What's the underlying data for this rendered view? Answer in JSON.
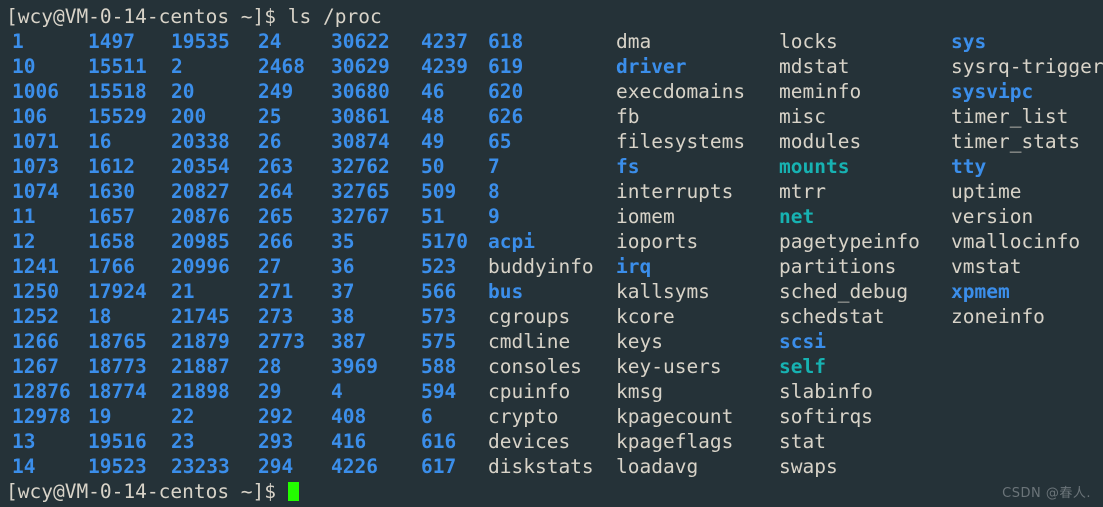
{
  "terminal": {
    "background_color": "#253238",
    "colors": {
      "file": "#d8d3c8",
      "directory": "#3b8eea",
      "symlink": "#17b2b2",
      "cursor": "#23fd00",
      "watermark": "#6b7479"
    },
    "prompt_top": "[wcy@VM-0-14-centos ~]$ ls /proc",
    "prompt_bottom": "[wcy@VM-0-14-centos ~]$ ",
    "watermark": "CSDN @春人.",
    "column_x": [
      6,
      82,
      165,
      252,
      325,
      415,
      482,
      610,
      773,
      945
    ],
    "rows": [
      [
        {
          "t": "1",
          "k": "dir"
        },
        {
          "t": "1497",
          "k": "dir"
        },
        {
          "t": "19535",
          "k": "dir"
        },
        {
          "t": "24",
          "k": "dir"
        },
        {
          "t": "30622",
          "k": "dir"
        },
        {
          "t": "4237",
          "k": "dir"
        },
        {
          "t": "618",
          "k": "dir"
        },
        {
          "t": "dma",
          "k": "file"
        },
        {
          "t": "locks",
          "k": "file"
        },
        {
          "t": "sys",
          "k": "dir"
        }
      ],
      [
        {
          "t": "10",
          "k": "dir"
        },
        {
          "t": "15511",
          "k": "dir"
        },
        {
          "t": "2",
          "k": "dir"
        },
        {
          "t": "2468",
          "k": "dir"
        },
        {
          "t": "30629",
          "k": "dir"
        },
        {
          "t": "4239",
          "k": "dir"
        },
        {
          "t": "619",
          "k": "dir"
        },
        {
          "t": "driver",
          "k": "dir"
        },
        {
          "t": "mdstat",
          "k": "file"
        },
        {
          "t": "sysrq-trigger",
          "k": "file"
        }
      ],
      [
        {
          "t": "1006",
          "k": "dir"
        },
        {
          "t": "15518",
          "k": "dir"
        },
        {
          "t": "20",
          "k": "dir"
        },
        {
          "t": "249",
          "k": "dir"
        },
        {
          "t": "30680",
          "k": "dir"
        },
        {
          "t": "46",
          "k": "dir"
        },
        {
          "t": "620",
          "k": "dir"
        },
        {
          "t": "execdomains",
          "k": "file"
        },
        {
          "t": "meminfo",
          "k": "file"
        },
        {
          "t": "sysvipc",
          "k": "dir"
        }
      ],
      [
        {
          "t": "106",
          "k": "dir"
        },
        {
          "t": "15529",
          "k": "dir"
        },
        {
          "t": "200",
          "k": "dir"
        },
        {
          "t": "25",
          "k": "dir"
        },
        {
          "t": "30861",
          "k": "dir"
        },
        {
          "t": "48",
          "k": "dir"
        },
        {
          "t": "626",
          "k": "dir"
        },
        {
          "t": "fb",
          "k": "file"
        },
        {
          "t": "misc",
          "k": "file"
        },
        {
          "t": "timer_list",
          "k": "file"
        }
      ],
      [
        {
          "t": "1071",
          "k": "dir"
        },
        {
          "t": "16",
          "k": "dir"
        },
        {
          "t": "20338",
          "k": "dir"
        },
        {
          "t": "26",
          "k": "dir"
        },
        {
          "t": "30874",
          "k": "dir"
        },
        {
          "t": "49",
          "k": "dir"
        },
        {
          "t": "65",
          "k": "dir"
        },
        {
          "t": "filesystems",
          "k": "file"
        },
        {
          "t": "modules",
          "k": "file"
        },
        {
          "t": "timer_stats",
          "k": "file"
        }
      ],
      [
        {
          "t": "1073",
          "k": "dir"
        },
        {
          "t": "1612",
          "k": "dir"
        },
        {
          "t": "20354",
          "k": "dir"
        },
        {
          "t": "263",
          "k": "dir"
        },
        {
          "t": "32762",
          "k": "dir"
        },
        {
          "t": "50",
          "k": "dir"
        },
        {
          "t": "7",
          "k": "dir"
        },
        {
          "t": "fs",
          "k": "dir"
        },
        {
          "t": "mounts",
          "k": "link"
        },
        {
          "t": "tty",
          "k": "dir"
        }
      ],
      [
        {
          "t": "1074",
          "k": "dir"
        },
        {
          "t": "1630",
          "k": "dir"
        },
        {
          "t": "20827",
          "k": "dir"
        },
        {
          "t": "264",
          "k": "dir"
        },
        {
          "t": "32765",
          "k": "dir"
        },
        {
          "t": "509",
          "k": "dir"
        },
        {
          "t": "8",
          "k": "dir"
        },
        {
          "t": "interrupts",
          "k": "file"
        },
        {
          "t": "mtrr",
          "k": "file"
        },
        {
          "t": "uptime",
          "k": "file"
        }
      ],
      [
        {
          "t": "11",
          "k": "dir"
        },
        {
          "t": "1657",
          "k": "dir"
        },
        {
          "t": "20876",
          "k": "dir"
        },
        {
          "t": "265",
          "k": "dir"
        },
        {
          "t": "32767",
          "k": "dir"
        },
        {
          "t": "51",
          "k": "dir"
        },
        {
          "t": "9",
          "k": "dir"
        },
        {
          "t": "iomem",
          "k": "file"
        },
        {
          "t": "net",
          "k": "link"
        },
        {
          "t": "version",
          "k": "file"
        }
      ],
      [
        {
          "t": "12",
          "k": "dir"
        },
        {
          "t": "1658",
          "k": "dir"
        },
        {
          "t": "20985",
          "k": "dir"
        },
        {
          "t": "266",
          "k": "dir"
        },
        {
          "t": "35",
          "k": "dir"
        },
        {
          "t": "5170",
          "k": "dir"
        },
        {
          "t": "acpi",
          "k": "dir"
        },
        {
          "t": "ioports",
          "k": "file"
        },
        {
          "t": "pagetypeinfo",
          "k": "file"
        },
        {
          "t": "vmallocinfo",
          "k": "file"
        }
      ],
      [
        {
          "t": "1241",
          "k": "dir"
        },
        {
          "t": "1766",
          "k": "dir"
        },
        {
          "t": "20996",
          "k": "dir"
        },
        {
          "t": "27",
          "k": "dir"
        },
        {
          "t": "36",
          "k": "dir"
        },
        {
          "t": "523",
          "k": "dir"
        },
        {
          "t": "buddyinfo",
          "k": "file"
        },
        {
          "t": "irq",
          "k": "dir"
        },
        {
          "t": "partitions",
          "k": "file"
        },
        {
          "t": "vmstat",
          "k": "file"
        }
      ],
      [
        {
          "t": "1250",
          "k": "dir"
        },
        {
          "t": "17924",
          "k": "dir"
        },
        {
          "t": "21",
          "k": "dir"
        },
        {
          "t": "271",
          "k": "dir"
        },
        {
          "t": "37",
          "k": "dir"
        },
        {
          "t": "566",
          "k": "dir"
        },
        {
          "t": "bus",
          "k": "dir"
        },
        {
          "t": "kallsyms",
          "k": "file"
        },
        {
          "t": "sched_debug",
          "k": "file"
        },
        {
          "t": "xpmem",
          "k": "dir"
        }
      ],
      [
        {
          "t": "1252",
          "k": "dir"
        },
        {
          "t": "18",
          "k": "dir"
        },
        {
          "t": "21745",
          "k": "dir"
        },
        {
          "t": "273",
          "k": "dir"
        },
        {
          "t": "38",
          "k": "dir"
        },
        {
          "t": "573",
          "k": "dir"
        },
        {
          "t": "cgroups",
          "k": "file"
        },
        {
          "t": "kcore",
          "k": "file"
        },
        {
          "t": "schedstat",
          "k": "file"
        },
        {
          "t": "zoneinfo",
          "k": "file"
        }
      ],
      [
        {
          "t": "1266",
          "k": "dir"
        },
        {
          "t": "18765",
          "k": "dir"
        },
        {
          "t": "21879",
          "k": "dir"
        },
        {
          "t": "2773",
          "k": "dir"
        },
        {
          "t": "387",
          "k": "dir"
        },
        {
          "t": "575",
          "k": "dir"
        },
        {
          "t": "cmdline",
          "k": "file"
        },
        {
          "t": "keys",
          "k": "file"
        },
        {
          "t": "scsi",
          "k": "dir"
        },
        {
          "t": "",
          "k": "file"
        }
      ],
      [
        {
          "t": "1267",
          "k": "dir"
        },
        {
          "t": "18773",
          "k": "dir"
        },
        {
          "t": "21887",
          "k": "dir"
        },
        {
          "t": "28",
          "k": "dir"
        },
        {
          "t": "3969",
          "k": "dir"
        },
        {
          "t": "588",
          "k": "dir"
        },
        {
          "t": "consoles",
          "k": "file"
        },
        {
          "t": "key-users",
          "k": "file"
        },
        {
          "t": "self",
          "k": "link"
        },
        {
          "t": "",
          "k": "file"
        }
      ],
      [
        {
          "t": "12876",
          "k": "dir"
        },
        {
          "t": "18774",
          "k": "dir"
        },
        {
          "t": "21898",
          "k": "dir"
        },
        {
          "t": "29",
          "k": "dir"
        },
        {
          "t": "4",
          "k": "dir"
        },
        {
          "t": "594",
          "k": "dir"
        },
        {
          "t": "cpuinfo",
          "k": "file"
        },
        {
          "t": "kmsg",
          "k": "file"
        },
        {
          "t": "slabinfo",
          "k": "file"
        },
        {
          "t": "",
          "k": "file"
        }
      ],
      [
        {
          "t": "12978",
          "k": "dir"
        },
        {
          "t": "19",
          "k": "dir"
        },
        {
          "t": "22",
          "k": "dir"
        },
        {
          "t": "292",
          "k": "dir"
        },
        {
          "t": "408",
          "k": "dir"
        },
        {
          "t": "6",
          "k": "dir"
        },
        {
          "t": "crypto",
          "k": "file"
        },
        {
          "t": "kpagecount",
          "k": "file"
        },
        {
          "t": "softirqs",
          "k": "file"
        },
        {
          "t": "",
          "k": "file"
        }
      ],
      [
        {
          "t": "13",
          "k": "dir"
        },
        {
          "t": "19516",
          "k": "dir"
        },
        {
          "t": "23",
          "k": "dir"
        },
        {
          "t": "293",
          "k": "dir"
        },
        {
          "t": "416",
          "k": "dir"
        },
        {
          "t": "616",
          "k": "dir"
        },
        {
          "t": "devices",
          "k": "file"
        },
        {
          "t": "kpageflags",
          "k": "file"
        },
        {
          "t": "stat",
          "k": "file"
        },
        {
          "t": "",
          "k": "file"
        }
      ],
      [
        {
          "t": "14",
          "k": "dir"
        },
        {
          "t": "19523",
          "k": "dir"
        },
        {
          "t": "23233",
          "k": "dir"
        },
        {
          "t": "294",
          "k": "dir"
        },
        {
          "t": "4226",
          "k": "dir"
        },
        {
          "t": "617",
          "k": "dir"
        },
        {
          "t": "diskstats",
          "k": "file"
        },
        {
          "t": "loadavg",
          "k": "file"
        },
        {
          "t": "swaps",
          "k": "file"
        },
        {
          "t": "",
          "k": "file"
        }
      ]
    ]
  }
}
